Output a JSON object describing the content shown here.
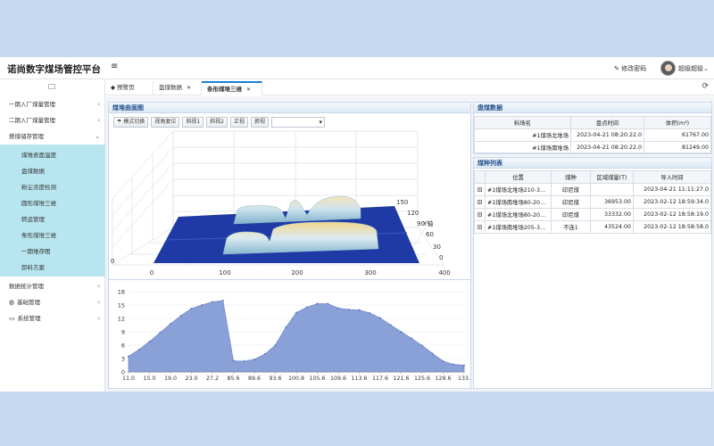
{
  "header": {
    "app_title": "诺尚数字煤场管控平台",
    "menu_icon": "hamburger-icon",
    "change_password": "修改密码",
    "user_name": "超级超级"
  },
  "sidebar": {
    "items": [
      {
        "label": "一期入厂煤量管理",
        "top": 9
      },
      {
        "label": "二期入厂煤量管理",
        "top": 27
      },
      {
        "label": "燃煤储存管理",
        "top": 45
      }
    ],
    "sub_items": [
      "煤堆表面温度",
      "盘煤数据",
      "粉尘浓度检测",
      "圆形煤堆三维",
      "转运管理",
      "条形煤堆三维",
      "一期堆存图",
      "卸料方案"
    ],
    "bottom_items": [
      "数据统计管理",
      "基础管理",
      "系统管理"
    ]
  },
  "tabs": [
    {
      "label": "预警页",
      "closable": false
    },
    {
      "label": "盘煤数据",
      "closable": true
    },
    {
      "label": "条形煤堆三维",
      "closable": true,
      "active": true
    }
  ],
  "surface_panel": {
    "title": "煤堆曲面图",
    "buttons": [
      "模式切换",
      "视角复位",
      "斜视1",
      "斜视2",
      "正视",
      "俯视"
    ],
    "axis_ticks_x": [
      "0",
      "100",
      "200",
      "300",
      "400"
    ],
    "axis_ticks_y": [
      "0",
      "30",
      "60",
      "90",
      "120",
      "150"
    ],
    "axis_ticks_z": [
      "0"
    ],
    "y_axis_label": "Y轴"
  },
  "profile_chart": {
    "y_ticks": [
      "0",
      "3",
      "6",
      "9",
      "12",
      "15",
      "18"
    ],
    "x_ticks": [
      "11.0",
      "15.0",
      "19.0",
      "23.0",
      "27.2",
      "85.6",
      "89.6",
      "93.6",
      "100.8",
      "105.6",
      "109.6",
      "113.6",
      "117.6",
      "121.6",
      "125.6",
      "129.6",
      "133."
    ]
  },
  "chart_data": {
    "type": "area",
    "x": [
      11.0,
      13.0,
      15.0,
      17.0,
      19.0,
      21.0,
      23.0,
      25.0,
      27.2,
      28.4,
      85.6,
      87.6,
      89.6,
      91.6,
      93.6,
      97.2,
      100.8,
      103.2,
      105.6,
      107.6,
      109.6,
      111.6,
      113.6,
      115.6,
      117.6,
      119.6,
      121.6,
      123.6,
      125.6,
      127.6,
      129.6,
      131.6,
      133.0
    ],
    "values": [
      3.5,
      5.0,
      6.8,
      8.8,
      10.8,
      12.6,
      14.2,
      15.0,
      15.7,
      16.0,
      2.5,
      2.4,
      2.8,
      4.0,
      6.0,
      10.0,
      13.3,
      14.5,
      15.3,
      15.3,
      14.3,
      14.0,
      13.9,
      13.2,
      12.1,
      10.5,
      9.0,
      7.5,
      5.9,
      4.1,
      2.4,
      1.7,
      1.5
    ],
    "ylim": [
      0,
      18
    ]
  },
  "pan_panel": {
    "title": "盘煤数据",
    "columns": [
      "料场名",
      "盘点时间",
      "体积(m³)"
    ],
    "rows": [
      [
        "#1煤场北堆场",
        "2023-04-21 08:20:22.0",
        "61767.00"
      ],
      [
        "#1煤场南堆场",
        "2023-04-21 08:20:22.0",
        "81249.00"
      ]
    ]
  },
  "coal_list": {
    "title": "煤种列表",
    "columns": [
      "位置",
      "煤种",
      "区域煤量(T)",
      "导入时间"
    ],
    "rows": [
      [
        "#1煤场北堆场210-3…",
        "印尼煤",
        "",
        "2023-04-21 11:11:27.0"
      ],
      [
        "#1煤场南堆场80-20…",
        "印尼煤",
        "36953.00",
        "2023-02-12 18:59:34.0"
      ],
      [
        "#1煤场北堆场80-20…",
        "印尼煤",
        "33332.00",
        "2023-02-12 18:58:19.0"
      ],
      [
        "#1煤场南堆场205-3…",
        "不连1",
        "43524.00",
        "2023-02-12 18:58:58.0"
      ]
    ]
  },
  "colors": {
    "accent": "#1c7fd1",
    "area_fill": "#8aa1d8",
    "area_stroke": "#6f88c9",
    "platform": "#1f3aa4",
    "submenu_bg": "#b8e6f0"
  }
}
